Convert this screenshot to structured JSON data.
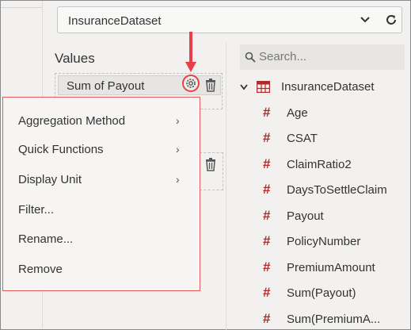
{
  "dataset_select": {
    "value": "InsuranceDataset"
  },
  "values_panel": {
    "heading": "Values",
    "field_pill": "Sum of Payout"
  },
  "context_menu": {
    "items": [
      {
        "label": "Aggregation Method",
        "submenu": true
      },
      {
        "label": "Quick Functions",
        "submenu": true
      },
      {
        "label": "Display Unit",
        "submenu": true
      },
      {
        "label": "Filter...",
        "submenu": false
      },
      {
        "label": "Rename...",
        "submenu": false
      },
      {
        "label": "Remove",
        "submenu": false
      }
    ],
    "submenu_glyph": "›"
  },
  "field_list": {
    "search_placeholder": "Search...",
    "root": "InsuranceDataset",
    "field_glyph": "#",
    "fields": [
      "Age",
      "CSAT",
      "ClaimRatio2",
      "DaysToSettleClaim",
      "Payout",
      "PolicyNumber",
      "PremiumAmount",
      "Sum(Payout)",
      "Sum(PremiumA..."
    ]
  },
  "colors": {
    "highlight": "#e8404a",
    "field_hash": "#b22b2b",
    "table_icon": "#b22b2b"
  }
}
